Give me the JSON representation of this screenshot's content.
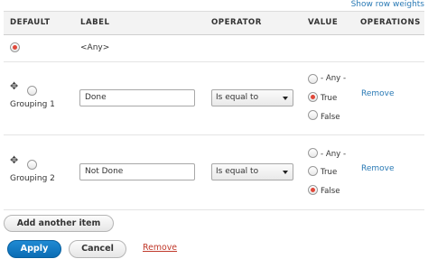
{
  "links": {
    "show_row_weights": "Show row weights"
  },
  "table": {
    "headers": {
      "default": "DEFAULT",
      "label": "LABEL",
      "operator": "OPERATOR",
      "value": "VALUE",
      "operations": "OPERATIONS"
    },
    "any_row": {
      "label": "<Any>",
      "default_selected": true
    },
    "rows": [
      {
        "grouping": "Grouping 1",
        "label_value": "Done",
        "operator": "Is equal to",
        "value_options": [
          "- Any -",
          "True",
          "False"
        ],
        "selected_value": "True",
        "remove_label": "Remove"
      },
      {
        "grouping": "Grouping 2",
        "label_value": "Not Done",
        "operator": "Is equal to",
        "value_options": [
          "- Any -",
          "True",
          "False"
        ],
        "selected_value": "False",
        "remove_label": "Remove"
      }
    ]
  },
  "buttons": {
    "add_item": "Add another item",
    "apply": "Apply",
    "cancel": "Cancel",
    "remove": "Remove"
  },
  "icons": {
    "drag_handle": "move-arrows-icon"
  },
  "colors": {
    "link": "#2a7ab5",
    "primary": "#0a6cb4",
    "danger_link": "#c0392b",
    "radio_selected": "#e0483a"
  }
}
